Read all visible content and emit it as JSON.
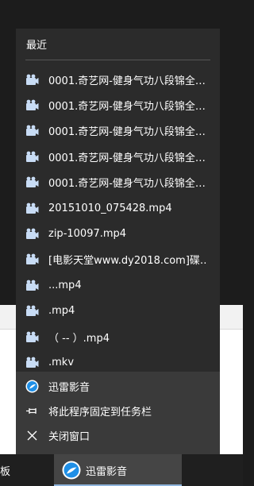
{
  "jumplist": {
    "recent_header": "最近",
    "recent_items": [
      {
        "label": "0001.奇艺网-健身气功八段锦全…",
        "icon": "video-file-icon"
      },
      {
        "label": "0001.奇艺网-健身气功八段锦全…",
        "icon": "video-file-icon"
      },
      {
        "label": "0001.奇艺网-健身气功八段锦全…",
        "icon": "video-file-icon"
      },
      {
        "label": "0001.奇艺网-健身气功八段锦全…",
        "icon": "video-file-icon"
      },
      {
        "label": "0001.奇艺网-健身气功八段锦全…",
        "icon": "video-file-icon"
      },
      {
        "label": "20151010_075428.mp4",
        "icon": "video-file-icon"
      },
      {
        "label": "zip-10097.mp4",
        "icon": "video-file-icon"
      },
      {
        "label": "[电影天堂www.dy2018.com]碟…",
        "icon": "video-file-icon"
      },
      {
        "label": "...mp4",
        "icon": "video-file-icon"
      },
      {
        "label": ".mp4",
        "icon": "video-file-icon"
      },
      {
        "label": "（ -- ）.mp4",
        "icon": "video-file-icon"
      },
      {
        "label": ".mkv",
        "icon": "video-file-icon"
      }
    ],
    "tasks": {
      "app_name": "迅雷影音",
      "pin_label": "将此程序固定到任务栏",
      "close_label": "关闭窗口"
    }
  },
  "taskbar": {
    "left_fragment": "板",
    "active_app_label": "迅雷影音"
  },
  "colors": {
    "panel_bg": "#2b2b2b",
    "task_section_bg": "#3a3a3a",
    "taskbar_bg": "#1f1f1f",
    "active_app_bg": "#454545",
    "file_icon": "#c8dcf5",
    "app_icon_blue": "#1f8fe6",
    "active_underline": "#8fb4dc"
  }
}
